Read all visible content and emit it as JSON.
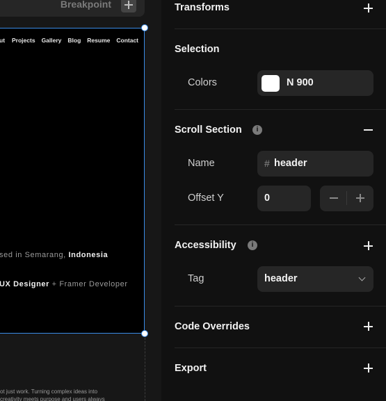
{
  "canvas": {
    "breakpoint_label": "Breakpoint",
    "nav_clipped": "ut",
    "nav_items": [
      "Projects",
      "Gallery",
      "Blog",
      "Resume",
      "Contact"
    ],
    "hero_line1_prefix": "sed in Semarang, ",
    "hero_line1_bold": "Indonesia",
    "hero_line2_bold": "UX Designer",
    "hero_line2_suffix": " + Framer Developer",
    "body_text_line1": "ot just work. Turning complex ideas into",
    "body_text_line2": "creativity meets purpose and users always"
  },
  "panel": {
    "transforms": {
      "title": "Transforms"
    },
    "selection": {
      "title": "Selection",
      "colors_label": "Colors",
      "color_value": "N 900",
      "swatch_color": "#ffffff"
    },
    "scroll_section": {
      "title": "Scroll Section",
      "name_label": "Name",
      "name_prefix": "#",
      "name_value": "header",
      "offset_label": "Offset Y",
      "offset_value": "0"
    },
    "accessibility": {
      "title": "Accessibility",
      "tag_label": "Tag",
      "tag_value": "header"
    },
    "code_overrides": {
      "title": "Code Overrides"
    },
    "export": {
      "title": "Export"
    }
  },
  "colors": {
    "selection_accent": "#3a8ce8",
    "panel_background": "#111111",
    "field_background": "#262626"
  },
  "icons": [
    "plus-icon",
    "minus-icon",
    "info-icon",
    "chevron-down-icon"
  ]
}
